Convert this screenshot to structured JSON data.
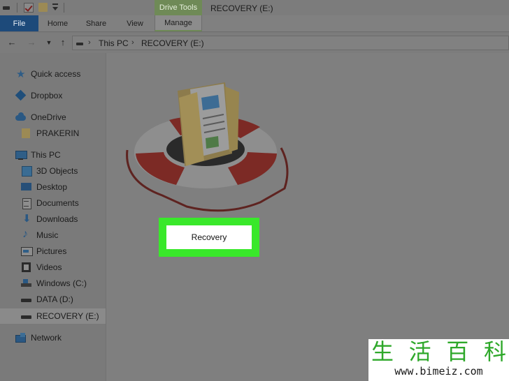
{
  "window": {
    "title": "RECOVERY (E:)",
    "context_tab_group": "Drive Tools"
  },
  "quick_access_toolbar": {
    "icons": [
      "drive-icon",
      "properties-check-icon",
      "new-folder-icon",
      "customize-toolbar-icon"
    ]
  },
  "ribbon": {
    "tabs": [
      {
        "label": "File",
        "active": false
      },
      {
        "label": "Home",
        "active": false
      },
      {
        "label": "Share",
        "active": false
      },
      {
        "label": "View",
        "active": false
      },
      {
        "label": "Manage",
        "active": true
      }
    ]
  },
  "address_bar": {
    "breadcrumbs": [
      "This PC",
      "RECOVERY (E:)"
    ],
    "nav_icons": [
      "back-arrow-icon",
      "forward-arrow-icon",
      "recent-locations-icon",
      "up-arrow-icon"
    ]
  },
  "sidebar": {
    "items": [
      {
        "label": "Quick access",
        "icon": "star-icon",
        "level": 1
      },
      {
        "label": "Dropbox",
        "icon": "dropbox-icon",
        "level": 1
      },
      {
        "label": "OneDrive",
        "icon": "cloud-icon",
        "level": 1
      },
      {
        "label": "PRAKERIN",
        "icon": "folder-icon",
        "level": 2
      },
      {
        "label": "This PC",
        "icon": "computer-icon",
        "level": 1
      },
      {
        "label": "3D Objects",
        "icon": "cube-icon",
        "level": 2
      },
      {
        "label": "Desktop",
        "icon": "desktop-icon",
        "level": 2
      },
      {
        "label": "Documents",
        "icon": "documents-icon",
        "level": 2
      },
      {
        "label": "Downloads",
        "icon": "download-icon",
        "level": 2
      },
      {
        "label": "Music",
        "icon": "music-icon",
        "level": 2
      },
      {
        "label": "Pictures",
        "icon": "pictures-icon",
        "level": 2
      },
      {
        "label": "Videos",
        "icon": "videos-icon",
        "level": 2
      },
      {
        "label": "Windows (C:)",
        "icon": "windows-drive-icon",
        "level": 2
      },
      {
        "label": "DATA (D:)",
        "icon": "drive-icon",
        "level": 2
      },
      {
        "label": "RECOVERY (E:)",
        "icon": "drive-icon",
        "level": 2,
        "selected": true
      },
      {
        "label": "Network",
        "icon": "network-icon",
        "level": 1
      }
    ]
  },
  "content": {
    "drive_icon": "lifebuoy-folder-icon",
    "rename_field_value": "Recovery",
    "highlight_color": "#39e82a"
  },
  "watermark": {
    "chars": [
      "生",
      "活",
      "百",
      "科"
    ],
    "url": "www.bimeiz.com"
  }
}
